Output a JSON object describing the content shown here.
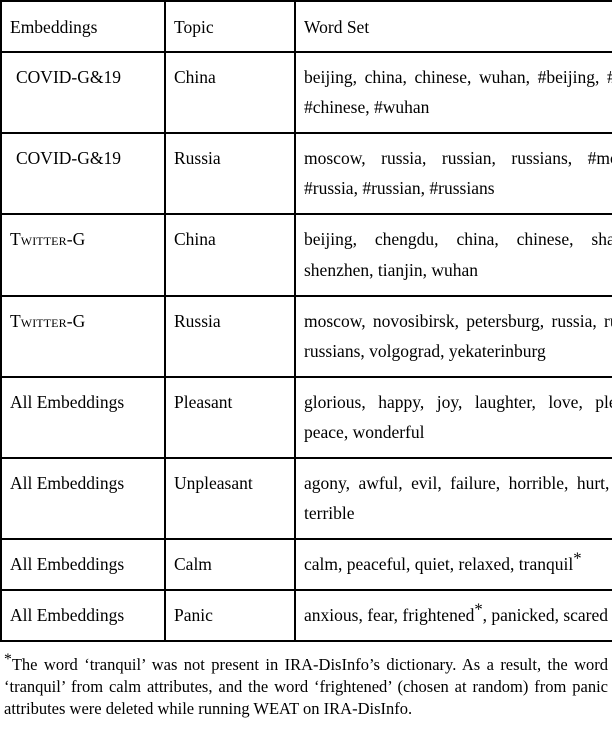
{
  "table": {
    "columns": [
      "Embeddings",
      "Topic",
      "Word Set"
    ],
    "rows": [
      {
        "embeddings": "COVID-G&19",
        "topic": "China",
        "words": "beijing, china, chinese, wuhan, #beijing, #china, #chinese, #wuhan"
      },
      {
        "embeddings": "COVID-G&19",
        "topic": "Russia",
        "words": "moscow, russia, russian, russians, #moscow, #russia, #russian, #russians"
      },
      {
        "embeddings": "Twitter-G",
        "topic": "China",
        "words": "beijing, chengdu, china, chinese, shanghai, shenzhen, tianjin, wuhan"
      },
      {
        "embeddings": "Twitter-G",
        "topic": "Russia",
        "words": "moscow, novosibirsk, petersburg, russia, russian, russians, volgograd, yekaterinburg"
      },
      {
        "embeddings": "All Embeddings",
        "topic": "Pleasant",
        "words": "glorious, happy, joy, laughter, love, pleasure, peace, wonderful"
      },
      {
        "embeddings": "All Embeddings",
        "topic": "Unpleasant",
        "words": "agony, awful, evil, failure, horrible, hurt, nasty, terrible"
      },
      {
        "embeddings": "All Embeddings",
        "topic": "Calm",
        "words": "calm, peaceful, quiet, relaxed, tranquil",
        "words_suffix_asterisk": true
      },
      {
        "embeddings": "All Embeddings",
        "topic": "Panic",
        "words_parts": [
          "anxious, fear, frightened",
          "*",
          ", panicked, scared"
        ]
      }
    ]
  },
  "footnote": {
    "marker": "*",
    "text": "The word ‘tranquil’ was not present in IRA-DisInfo’s dictionary. As a result, the word ‘tranquil’ from calm attributes, and the word ‘frightened’ (chosen at random) from panic attributes were deleted while running WEAT on IRA-DisInfo."
  }
}
